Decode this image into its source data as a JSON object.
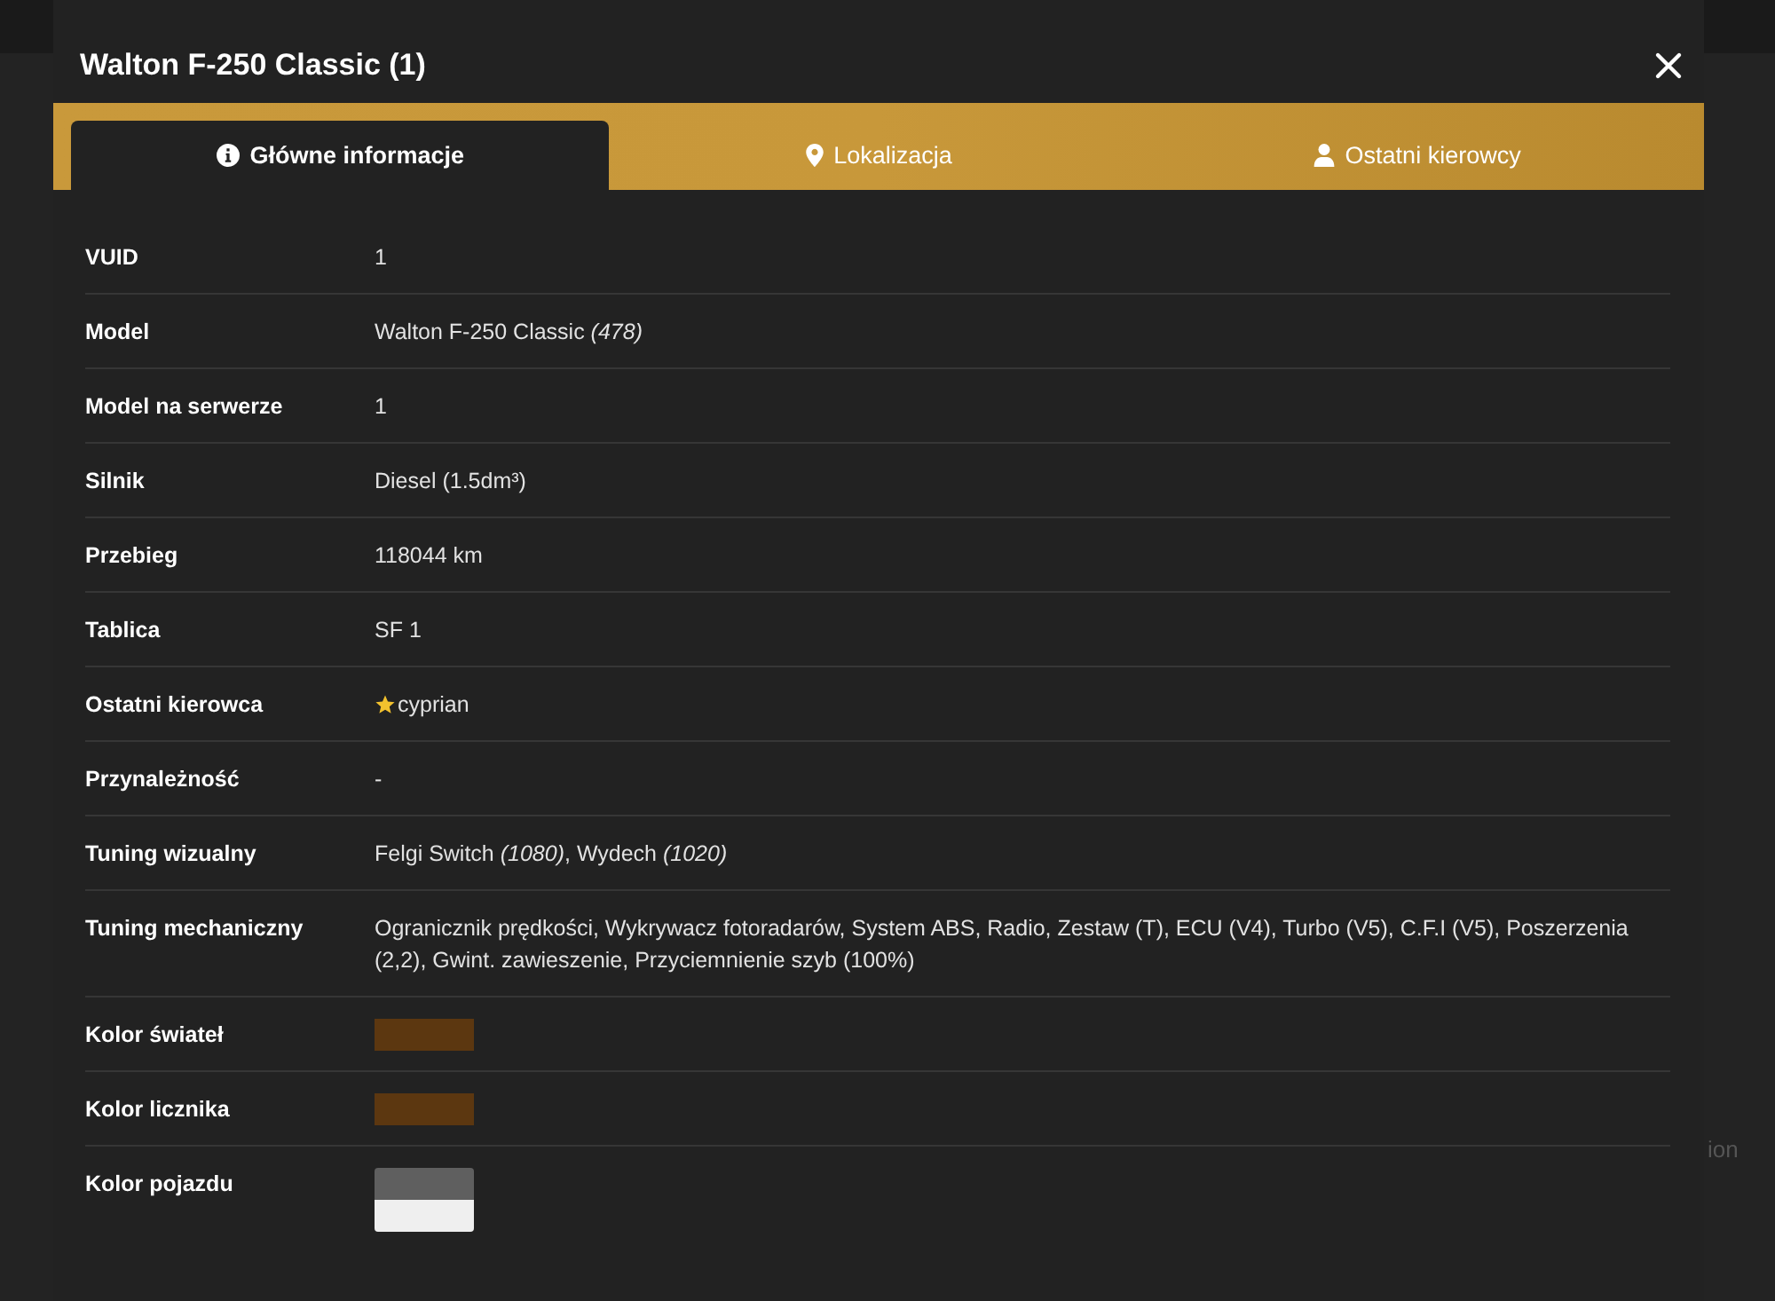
{
  "background": {
    "texts": [
      "ion"
    ]
  },
  "modal": {
    "title": "Walton F-250 Classic (1)",
    "tabs": [
      {
        "label": "Główne informacje",
        "selected": true
      },
      {
        "label": "Lokalizacja",
        "selected": false
      },
      {
        "label": "Ostatni kierowcy",
        "selected": false
      }
    ],
    "rows": [
      {
        "label": "VUID",
        "kind": "text",
        "value": "1"
      },
      {
        "label": "Model",
        "kind": "text",
        "value": "Walton F-250 Classic *(478)*"
      },
      {
        "label": "Model na serwerze",
        "kind": "text",
        "value": "1"
      },
      {
        "label": "Silnik",
        "kind": "text",
        "value": "Diesel (1.5dm³)"
      },
      {
        "label": "Przebieg",
        "kind": "text",
        "value": "118044 km"
      },
      {
        "label": "Tablica",
        "kind": "text",
        "value": "SF 1"
      },
      {
        "label": "Ostatni kierowca",
        "kind": "driver",
        "value": "cyprian",
        "starred": true
      },
      {
        "label": "Przynależność",
        "kind": "text",
        "value": "-"
      },
      {
        "label": "Tuning wizualny",
        "kind": "text",
        "value": "Felgi Switch *(1080)*, Wydech *(1020)*"
      },
      {
        "label": "Tuning mechaniczny",
        "kind": "text",
        "value": "Ogranicznik prędkości, Wykrywacz fotoradarów, System ABS, Radio, Zestaw (T), ECU (V4), Turbo (V5), C.F.I (V5), Poszerzenia (2,2), Gwint. zawieszenie, Przyciemnienie szyb (100%)"
      },
      {
        "label": "Kolor świateł",
        "kind": "swatches",
        "swatches": [
          {
            "color": "#5c3710"
          }
        ]
      },
      {
        "label": "Kolor licznika",
        "kind": "swatches",
        "swatches": [
          {
            "color": "#5c3710"
          }
        ]
      },
      {
        "label": "Kolor pojazdu",
        "kind": "swatches",
        "swatches": [
          {
            "color": "#5f5f5f"
          },
          {
            "color": "#efefef"
          }
        ]
      }
    ]
  }
}
